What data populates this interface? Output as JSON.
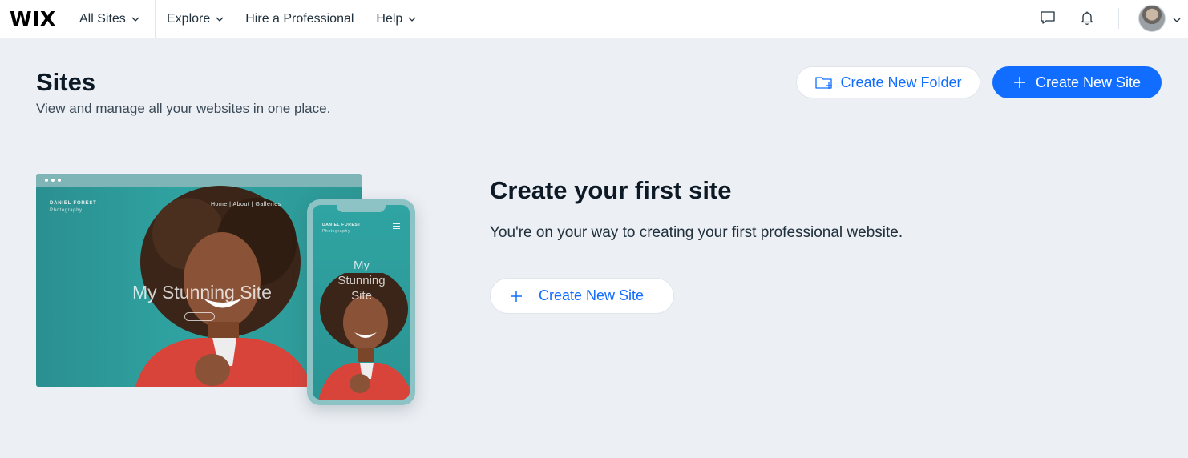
{
  "nav": {
    "logo": "WIX",
    "all_sites": "All Sites",
    "explore": "Explore",
    "hire": "Hire a Professional",
    "help": "Help"
  },
  "header": {
    "title": "Sites",
    "subtitle": "View and manage all your websites in one place.",
    "create_folder_label": "Create New Folder",
    "create_site_label": "Create New Site"
  },
  "illustration": {
    "brand_name": "DANIEL FOREST",
    "brand_tag": "Photography",
    "menu": "Home  |  About  |  Galleries",
    "headline_desktop": "My Stunning Site",
    "headline_mobile": "My Stunning Site"
  },
  "empty_state": {
    "title": "Create your first site",
    "description": "You're on your way to creating your first professional website.",
    "button_label": "Create New Site"
  },
  "colors": {
    "accent": "#116dff",
    "page_bg": "#eceff4",
    "teal": "#2a9d9b"
  }
}
